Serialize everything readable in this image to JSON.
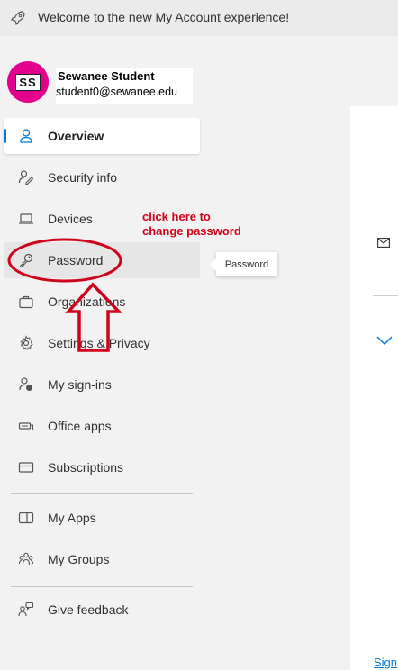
{
  "banner": {
    "text": "Welcome to the new My Account experience!",
    "icon": "rocket-icon"
  },
  "profile": {
    "initials": "SS",
    "name": "Sewanee Student",
    "email": "student0@sewanee.edu",
    "avatar_color": "#e3008c"
  },
  "nav": {
    "items": [
      {
        "label": "Overview",
        "icon": "person-icon",
        "active": true
      },
      {
        "label": "Security info",
        "icon": "security-info-icon"
      },
      {
        "label": "Devices",
        "icon": "laptop-icon"
      },
      {
        "label": "Password",
        "icon": "key-icon"
      },
      {
        "label": "Organizations",
        "icon": "briefcase-icon"
      },
      {
        "label": "Settings & Privacy",
        "icon": "gear-icon"
      },
      {
        "label": "My sign-ins",
        "icon": "sign-ins-icon"
      },
      {
        "label": "Office apps",
        "icon": "office-apps-icon"
      },
      {
        "label": "Subscriptions",
        "icon": "card-icon"
      },
      {
        "label": "My Apps",
        "icon": "apps-icon"
      },
      {
        "label": "My Groups",
        "icon": "groups-icon"
      },
      {
        "label": "Give feedback",
        "icon": "feedback-icon"
      }
    ]
  },
  "tooltip": {
    "text": "Password"
  },
  "annotation": {
    "line1": "click here to",
    "line2": "change password",
    "color": "#d0021b"
  },
  "main": {
    "sign_link": "Sign"
  },
  "colors": {
    "accent": "#0078d4",
    "annotation_red": "#d0021b",
    "sidebar_bg": "#f2f2f2"
  }
}
